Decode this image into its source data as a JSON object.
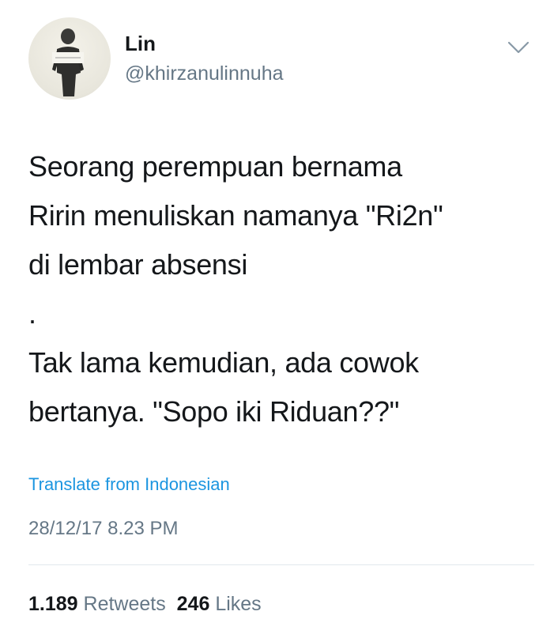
{
  "tweet": {
    "author": {
      "display_name": "Lin",
      "handle": "@khirzanulinnuha"
    },
    "text_lines": [
      "Seorang perempuan bernama",
      "Ririn menuliskan namanya \"Ri2n\"",
      "di lembar absensi",
      ".",
      "Tak lama kemudian, ada cowok",
      "bertanya. \"Sopo iki Riduan??\""
    ],
    "translate_label": "Translate from Indonesian",
    "timestamp": "28/12/17 8.23 PM",
    "stats": {
      "retweets_count": "1.189",
      "retweets_label": "Retweets",
      "likes_count": "246",
      "likes_label": "Likes"
    }
  },
  "icons": {
    "menu": "chevron-down-icon"
  },
  "colors": {
    "text_primary": "#14171a",
    "text_secondary": "#657786",
    "link": "#1b95e0",
    "divider": "#e1e8ed"
  }
}
